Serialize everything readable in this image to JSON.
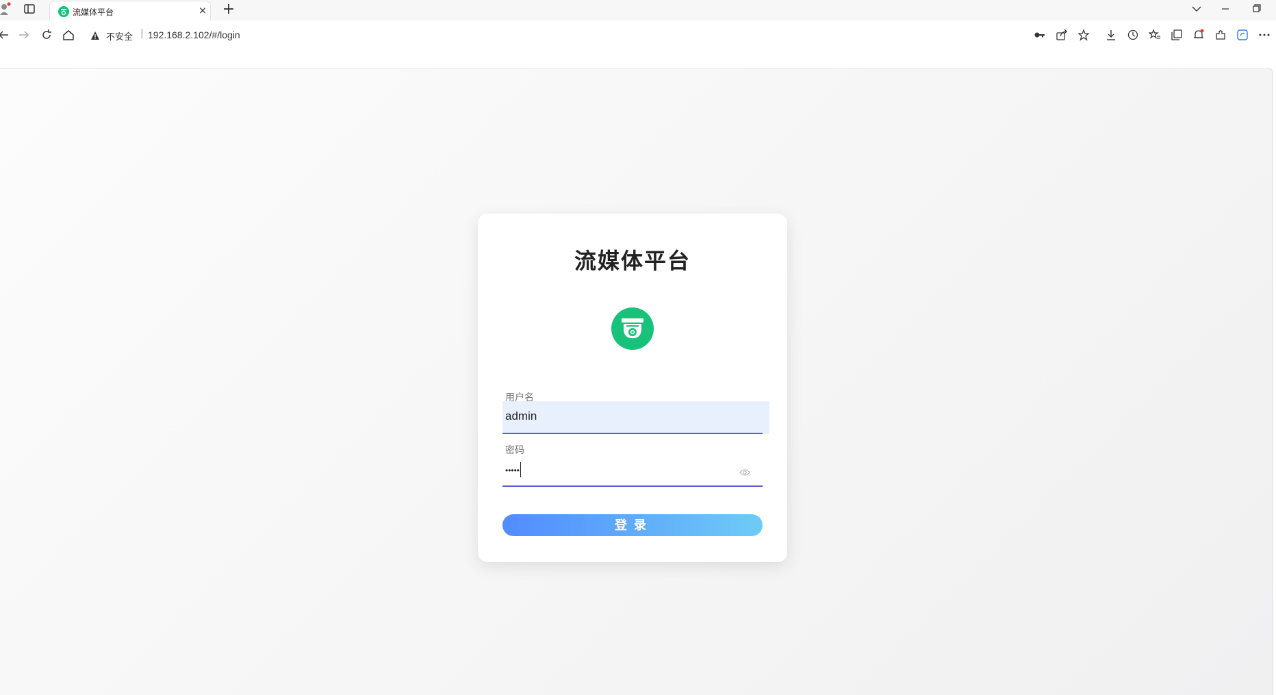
{
  "browser": {
    "tab_title": "流媒体平台",
    "insecure_label": "不安全",
    "url_separator": "|",
    "url": "192.168.2.102/#/login",
    "new_tab_symbol": "+",
    "close_symbol": "×"
  },
  "login": {
    "title": "流媒体平台",
    "username_label": "用户名",
    "username_value": "admin",
    "password_label": "密码",
    "password_masked": "•••••",
    "login_button_label": "登录"
  },
  "colors": {
    "logo_green": "#18c27a",
    "underline_active": "#5b5bd6",
    "button_gradient_start": "#528bff",
    "button_gradient_end": "#6ecbf5"
  }
}
